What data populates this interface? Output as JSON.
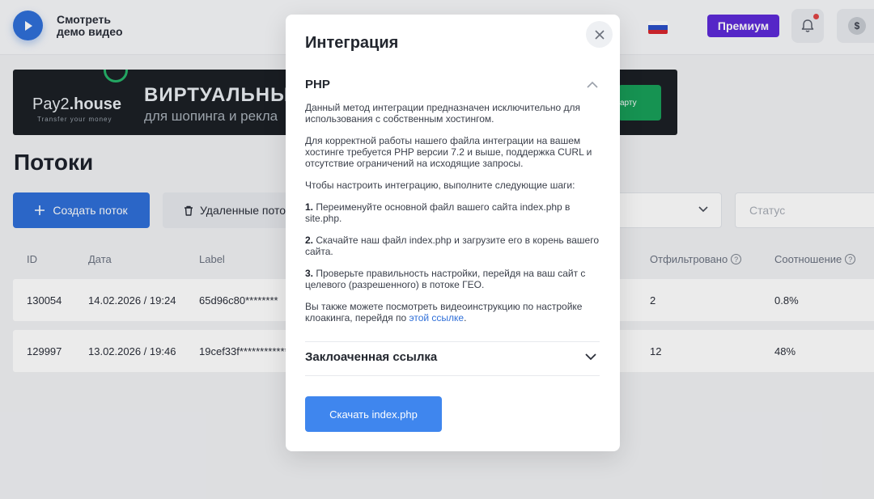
{
  "header": {
    "demo_label_line1": "Смотреть",
    "demo_label_line2": "демо видео",
    "premium_label": "Премиум",
    "balance_symbol": "$"
  },
  "banner": {
    "logo_main": "Pay2",
    "logo_suffix": ".house",
    "logo_tagline": "Transfer your money",
    "title": "ВИРТУАЛЬНЫ",
    "subtitle": "для шопинга и рекла",
    "button_label": "арту"
  },
  "page": {
    "title": "Потоки",
    "create_button": "Создать поток",
    "deleted_button": "Удаленные пото",
    "status_placeholder": "Статус"
  },
  "table": {
    "columns": {
      "id": "ID",
      "date": "Дата",
      "label": "Label",
      "filtered": "Отфильтровано",
      "ratio": "Соотношение"
    },
    "rows": [
      {
        "id": "130054",
        "date": "14.02.2026 / 19:24",
        "label": "65d96c80********",
        "filtered": "2",
        "ratio": "0.8%"
      },
      {
        "id": "129997",
        "date": "13.02.2026 / 19:46",
        "label": "19cef33f************",
        "filtered": "12",
        "ratio": "48%"
      }
    ]
  },
  "modal": {
    "title": "Интеграция",
    "php_section_title": "PHP",
    "intro": "Данный метод интеграции предназначен исключительно для использования с собственным хостингом.",
    "requirements": "Для корректной работы нашего файла интеграции на вашем хостинге требуется PHP версии 7.2 и выше, поддержка CURL и отсутствие ограничений на исходящие запросы.",
    "steps_intro": "Чтобы настроить интеграцию, выполните следующие шаги:",
    "step1_num": "1.",
    "step1": " Переименуйте основной файл вашего сайта index.php в site.php.",
    "step2_num": "2.",
    "step2": " Скачайте наш файл index.php и загрузите его в корень вашего сайта.",
    "step3_num": "3.",
    "step3": " Проверьте правильность настройки, перейдя на ваш сайт с целевого (разрешенного) в потоке ГЕО.",
    "video_text": "Вы также можете посмотреть видеоинструкцию по настройке клоакинга, перейдя по ",
    "video_link": "этой ссылке",
    "video_end": ".",
    "cloaked_section_title": "Заклоаченная ссылка",
    "download_button": "Скачать index.php"
  },
  "colors": {
    "primary": "#2f6fd8",
    "premium": "#5d2ad8",
    "download": "#3f86ee"
  }
}
